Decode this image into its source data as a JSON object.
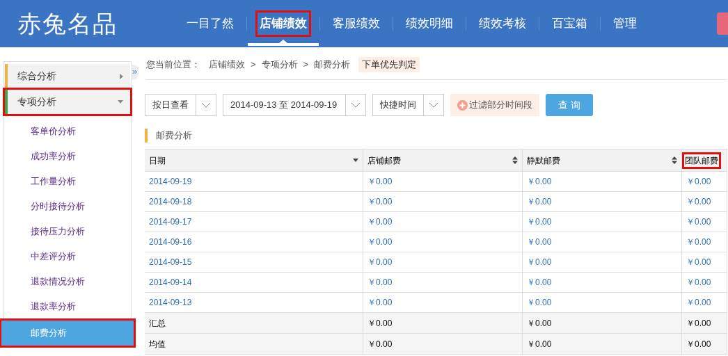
{
  "header": {
    "logo": "赤兔名品",
    "nav": [
      {
        "label": "一目了然",
        "selected": false,
        "highlighted": false
      },
      {
        "label": "店铺绩效",
        "selected": true,
        "highlighted": true
      },
      {
        "label": "客服绩效",
        "selected": false,
        "highlighted": false
      },
      {
        "label": "绩效明细",
        "selected": false,
        "highlighted": false
      },
      {
        "label": "绩效考核",
        "selected": false,
        "highlighted": false
      },
      {
        "label": "百宝箱",
        "selected": false,
        "highlighted": false
      },
      {
        "label": "管理",
        "selected": false,
        "highlighted": false
      }
    ]
  },
  "sidebar": {
    "toggle": "»",
    "groups": [
      {
        "label": "综合分析",
        "expanded": false,
        "highlighted": false,
        "color": "#f0b23c"
      },
      {
        "label": "专项分析",
        "expanded": true,
        "highlighted": true,
        "color": "#3aa84a",
        "children": [
          {
            "label": "客单价分析",
            "selected": false,
            "highlighted": false
          },
          {
            "label": "成功率分析",
            "selected": false,
            "highlighted": false
          },
          {
            "label": "工作量分析",
            "selected": false,
            "highlighted": false
          },
          {
            "label": "分时接待分析",
            "selected": false,
            "highlighted": false
          },
          {
            "label": "接待压力分析",
            "selected": false,
            "highlighted": false
          },
          {
            "label": "中差评分析",
            "selected": false,
            "highlighted": false
          },
          {
            "label": "退款情况分析",
            "selected": false,
            "highlighted": false
          },
          {
            "label": "退款率分析",
            "selected": false,
            "highlighted": false
          },
          {
            "label": "邮费分析",
            "selected": true,
            "highlighted": true
          }
        ]
      }
    ]
  },
  "breadcrumb": {
    "label": "您当前位置：",
    "path": [
      "店铺绩效",
      ">",
      "专项分析",
      ">",
      "邮费分析"
    ],
    "tag": "下单优先判定"
  },
  "filters": {
    "view": "按日查看",
    "date_range": "2014-09-13 至 2014-09-19",
    "quick_time": "快捷时间",
    "filter_button": "过滤部分时间段",
    "query_button": "查 询"
  },
  "section_title": "邮费分析",
  "table": {
    "columns": [
      {
        "label": "日期",
        "kind": "sorted",
        "highlighted": false
      },
      {
        "label": "店铺邮费",
        "kind": "sortable",
        "highlighted": false
      },
      {
        "label": "静默邮费",
        "kind": "sortable",
        "highlighted": false
      },
      {
        "label": "团队邮费",
        "kind": "plain",
        "highlighted": true
      }
    ],
    "rows": [
      [
        "2014-09-19",
        "￥0.00",
        "￥0.00",
        "￥0.00"
      ],
      [
        "2014-09-18",
        "￥0.00",
        "￥0.00",
        "￥0.00"
      ],
      [
        "2014-09-17",
        "￥0.00",
        "￥0.00",
        "￥0.00"
      ],
      [
        "2014-09-16",
        "￥0.00",
        "￥0.00",
        "￥0.00"
      ],
      [
        "2014-09-15",
        "￥0.00",
        "￥0.00",
        "￥0.00"
      ],
      [
        "2014-09-14",
        "￥0.00",
        "￥0.00",
        "￥0.00"
      ],
      [
        "2014-09-13",
        "￥0.00",
        "￥0.00",
        "￥0.00"
      ]
    ],
    "summary_rows": [
      [
        "汇总",
        "￥0.00",
        "￥0.00",
        "￥0.00"
      ],
      [
        "均值",
        "￥0.00",
        "￥0.00",
        "￥0.00"
      ]
    ]
  }
}
